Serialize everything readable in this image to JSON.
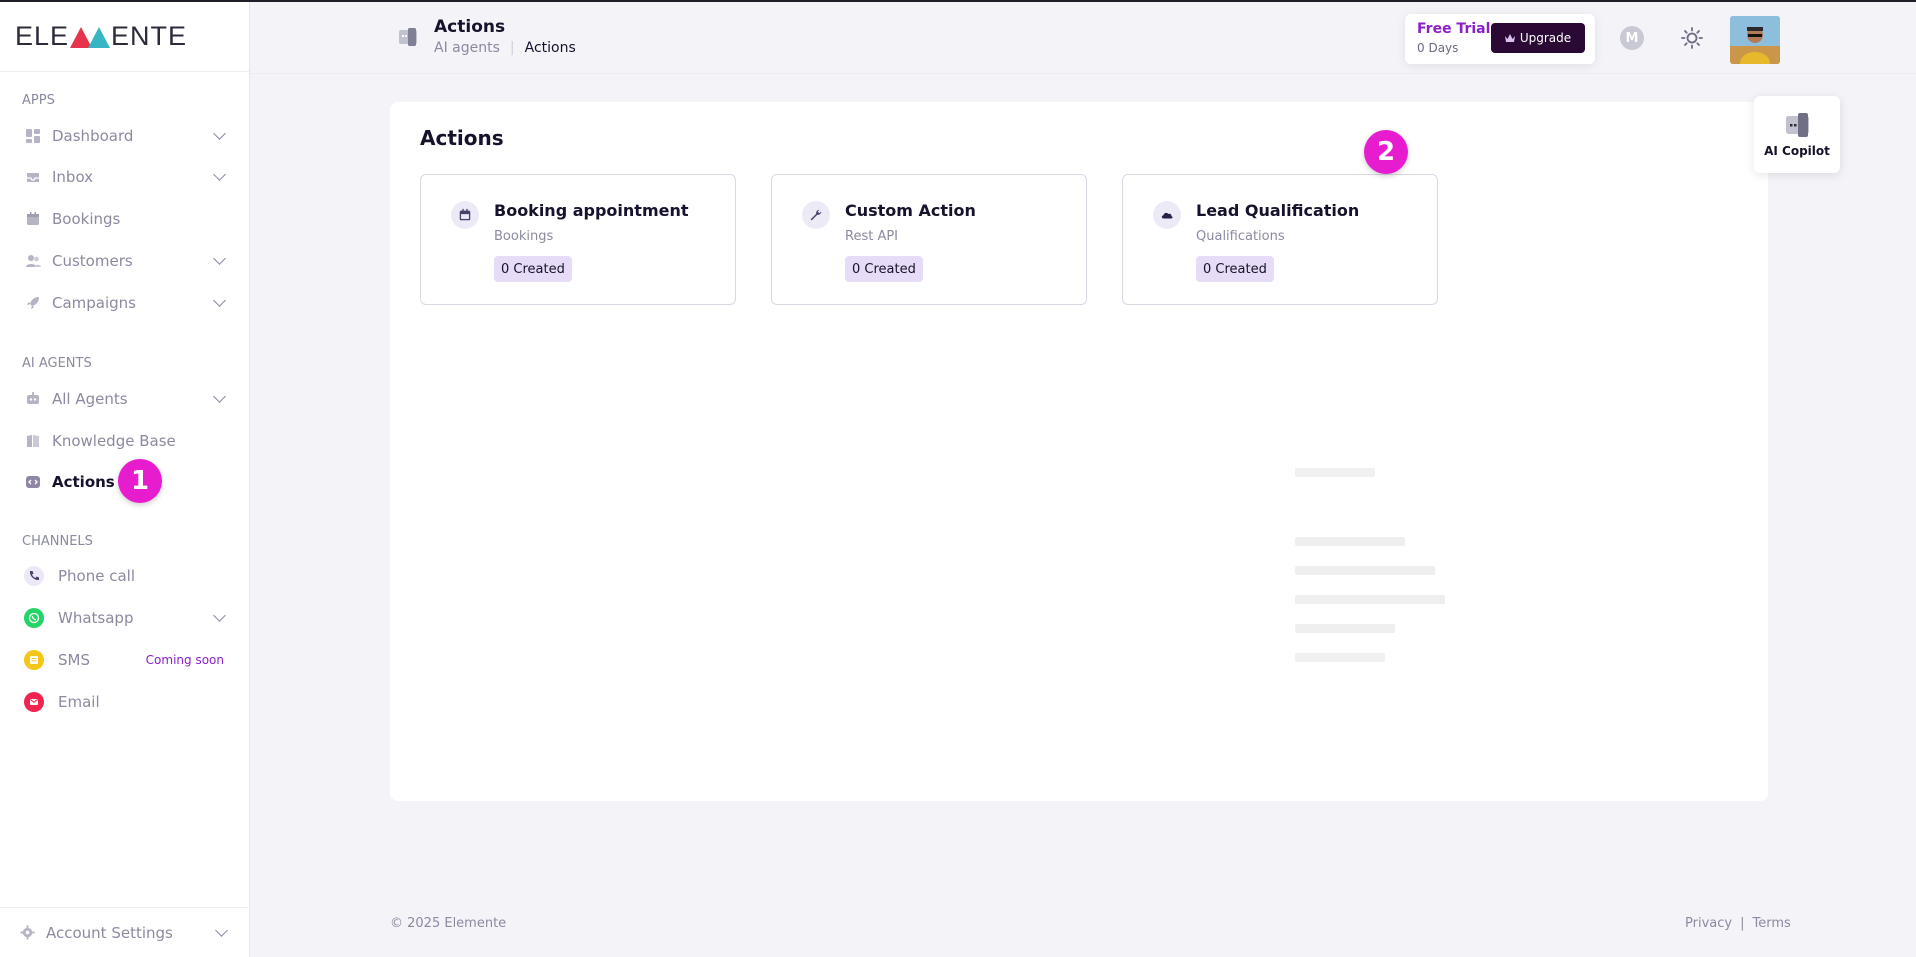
{
  "brand": {
    "name_left": "ELE",
    "name_right": "ENTE"
  },
  "sidebar": {
    "apps_label": "APPS",
    "apps": [
      {
        "label": "Dashboard",
        "icon": "dashboard-icon"
      },
      {
        "label": "Inbox",
        "icon": "inbox-icon"
      },
      {
        "label": "Bookings",
        "icon": "calendar-icon"
      },
      {
        "label": "Customers",
        "icon": "users-icon"
      },
      {
        "label": "Campaigns",
        "icon": "rocket-icon"
      }
    ],
    "agents_label": "AI AGENTS",
    "agents": [
      {
        "label": "All Agents",
        "icon": "agents-icon"
      },
      {
        "label": "Knowledge Base",
        "icon": "book-icon"
      },
      {
        "label": "Actions",
        "icon": "code-icon"
      }
    ],
    "channels_label": "CHANNELS",
    "channels": [
      {
        "label": "Phone call",
        "icon": "phone-icon"
      },
      {
        "label": "Whatsapp",
        "icon": "whatsapp-icon"
      },
      {
        "label": "SMS",
        "icon": "sms-icon",
        "badge": "Coming soon"
      },
      {
        "label": "Email",
        "icon": "email-icon"
      }
    ],
    "account": "Account Settings"
  },
  "markers": {
    "one": "1",
    "two": "2"
  },
  "header": {
    "title": "Actions",
    "breadcrumb": {
      "parent": "AI agents",
      "current": "Actions"
    },
    "trial": {
      "title": "Free Trial",
      "days": "0 Days",
      "upgrade": "Upgrade"
    },
    "user_initial": "M"
  },
  "main": {
    "title": "Actions",
    "cards": [
      {
        "title": "Booking appointment",
        "subtitle": "Bookings",
        "count": "0 Created",
        "icon": "calendar-icon"
      },
      {
        "title": "Custom Action",
        "subtitle": "Rest API",
        "count": "0 Created",
        "icon": "wrench-icon"
      },
      {
        "title": "Lead Qualification",
        "subtitle": "Qualifications",
        "count": "0 Created",
        "icon": "cloud-icon"
      }
    ]
  },
  "copilot": {
    "label": "AI Copilot"
  },
  "footer": {
    "copyright": "© 2025 Elemente",
    "privacy": "Privacy",
    "separator": "|",
    "terms": "Terms"
  },
  "colors": {
    "accent": "#8b1fc9",
    "marker": "#e81ccf",
    "upgrade_bg": "#2a0a35",
    "pill_bg": "#e6dcf8"
  }
}
